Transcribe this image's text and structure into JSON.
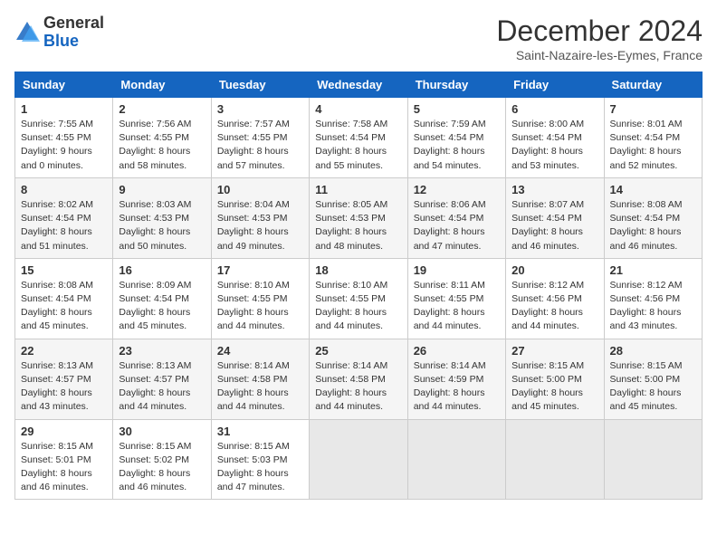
{
  "header": {
    "logo_general": "General",
    "logo_blue": "Blue",
    "title": "December 2024",
    "subtitle": "Saint-Nazaire-les-Eymes, France"
  },
  "weekdays": [
    "Sunday",
    "Monday",
    "Tuesday",
    "Wednesday",
    "Thursday",
    "Friday",
    "Saturday"
  ],
  "weeks": [
    [
      {
        "day": "1",
        "sunrise": "7:55 AM",
        "sunset": "4:55 PM",
        "daylight": "9 hours and 0 minutes."
      },
      {
        "day": "2",
        "sunrise": "7:56 AM",
        "sunset": "4:55 PM",
        "daylight": "8 hours and 58 minutes."
      },
      {
        "day": "3",
        "sunrise": "7:57 AM",
        "sunset": "4:55 PM",
        "daylight": "8 hours and 57 minutes."
      },
      {
        "day": "4",
        "sunrise": "7:58 AM",
        "sunset": "4:54 PM",
        "daylight": "8 hours and 55 minutes."
      },
      {
        "day": "5",
        "sunrise": "7:59 AM",
        "sunset": "4:54 PM",
        "daylight": "8 hours and 54 minutes."
      },
      {
        "day": "6",
        "sunrise": "8:00 AM",
        "sunset": "4:54 PM",
        "daylight": "8 hours and 53 minutes."
      },
      {
        "day": "7",
        "sunrise": "8:01 AM",
        "sunset": "4:54 PM",
        "daylight": "8 hours and 52 minutes."
      }
    ],
    [
      {
        "day": "8",
        "sunrise": "8:02 AM",
        "sunset": "4:54 PM",
        "daylight": "8 hours and 51 minutes."
      },
      {
        "day": "9",
        "sunrise": "8:03 AM",
        "sunset": "4:53 PM",
        "daylight": "8 hours and 50 minutes."
      },
      {
        "day": "10",
        "sunrise": "8:04 AM",
        "sunset": "4:53 PM",
        "daylight": "8 hours and 49 minutes."
      },
      {
        "day": "11",
        "sunrise": "8:05 AM",
        "sunset": "4:53 PM",
        "daylight": "8 hours and 48 minutes."
      },
      {
        "day": "12",
        "sunrise": "8:06 AM",
        "sunset": "4:54 PM",
        "daylight": "8 hours and 47 minutes."
      },
      {
        "day": "13",
        "sunrise": "8:07 AM",
        "sunset": "4:54 PM",
        "daylight": "8 hours and 46 minutes."
      },
      {
        "day": "14",
        "sunrise": "8:08 AM",
        "sunset": "4:54 PM",
        "daylight": "8 hours and 46 minutes."
      }
    ],
    [
      {
        "day": "15",
        "sunrise": "8:08 AM",
        "sunset": "4:54 PM",
        "daylight": "8 hours and 45 minutes."
      },
      {
        "day": "16",
        "sunrise": "8:09 AM",
        "sunset": "4:54 PM",
        "daylight": "8 hours and 45 minutes."
      },
      {
        "day": "17",
        "sunrise": "8:10 AM",
        "sunset": "4:55 PM",
        "daylight": "8 hours and 44 minutes."
      },
      {
        "day": "18",
        "sunrise": "8:10 AM",
        "sunset": "4:55 PM",
        "daylight": "8 hours and 44 minutes."
      },
      {
        "day": "19",
        "sunrise": "8:11 AM",
        "sunset": "4:55 PM",
        "daylight": "8 hours and 44 minutes."
      },
      {
        "day": "20",
        "sunrise": "8:12 AM",
        "sunset": "4:56 PM",
        "daylight": "8 hours and 44 minutes."
      },
      {
        "day": "21",
        "sunrise": "8:12 AM",
        "sunset": "4:56 PM",
        "daylight": "8 hours and 43 minutes."
      }
    ],
    [
      {
        "day": "22",
        "sunrise": "8:13 AM",
        "sunset": "4:57 PM",
        "daylight": "8 hours and 43 minutes."
      },
      {
        "day": "23",
        "sunrise": "8:13 AM",
        "sunset": "4:57 PM",
        "daylight": "8 hours and 44 minutes."
      },
      {
        "day": "24",
        "sunrise": "8:14 AM",
        "sunset": "4:58 PM",
        "daylight": "8 hours and 44 minutes."
      },
      {
        "day": "25",
        "sunrise": "8:14 AM",
        "sunset": "4:58 PM",
        "daylight": "8 hours and 44 minutes."
      },
      {
        "day": "26",
        "sunrise": "8:14 AM",
        "sunset": "4:59 PM",
        "daylight": "8 hours and 44 minutes."
      },
      {
        "day": "27",
        "sunrise": "8:15 AM",
        "sunset": "5:00 PM",
        "daylight": "8 hours and 45 minutes."
      },
      {
        "day": "28",
        "sunrise": "8:15 AM",
        "sunset": "5:00 PM",
        "daylight": "8 hours and 45 minutes."
      }
    ],
    [
      {
        "day": "29",
        "sunrise": "8:15 AM",
        "sunset": "5:01 PM",
        "daylight": "8 hours and 46 minutes."
      },
      {
        "day": "30",
        "sunrise": "8:15 AM",
        "sunset": "5:02 PM",
        "daylight": "8 hours and 46 minutes."
      },
      {
        "day": "31",
        "sunrise": "8:15 AM",
        "sunset": "5:03 PM",
        "daylight": "8 hours and 47 minutes."
      },
      null,
      null,
      null,
      null
    ]
  ]
}
